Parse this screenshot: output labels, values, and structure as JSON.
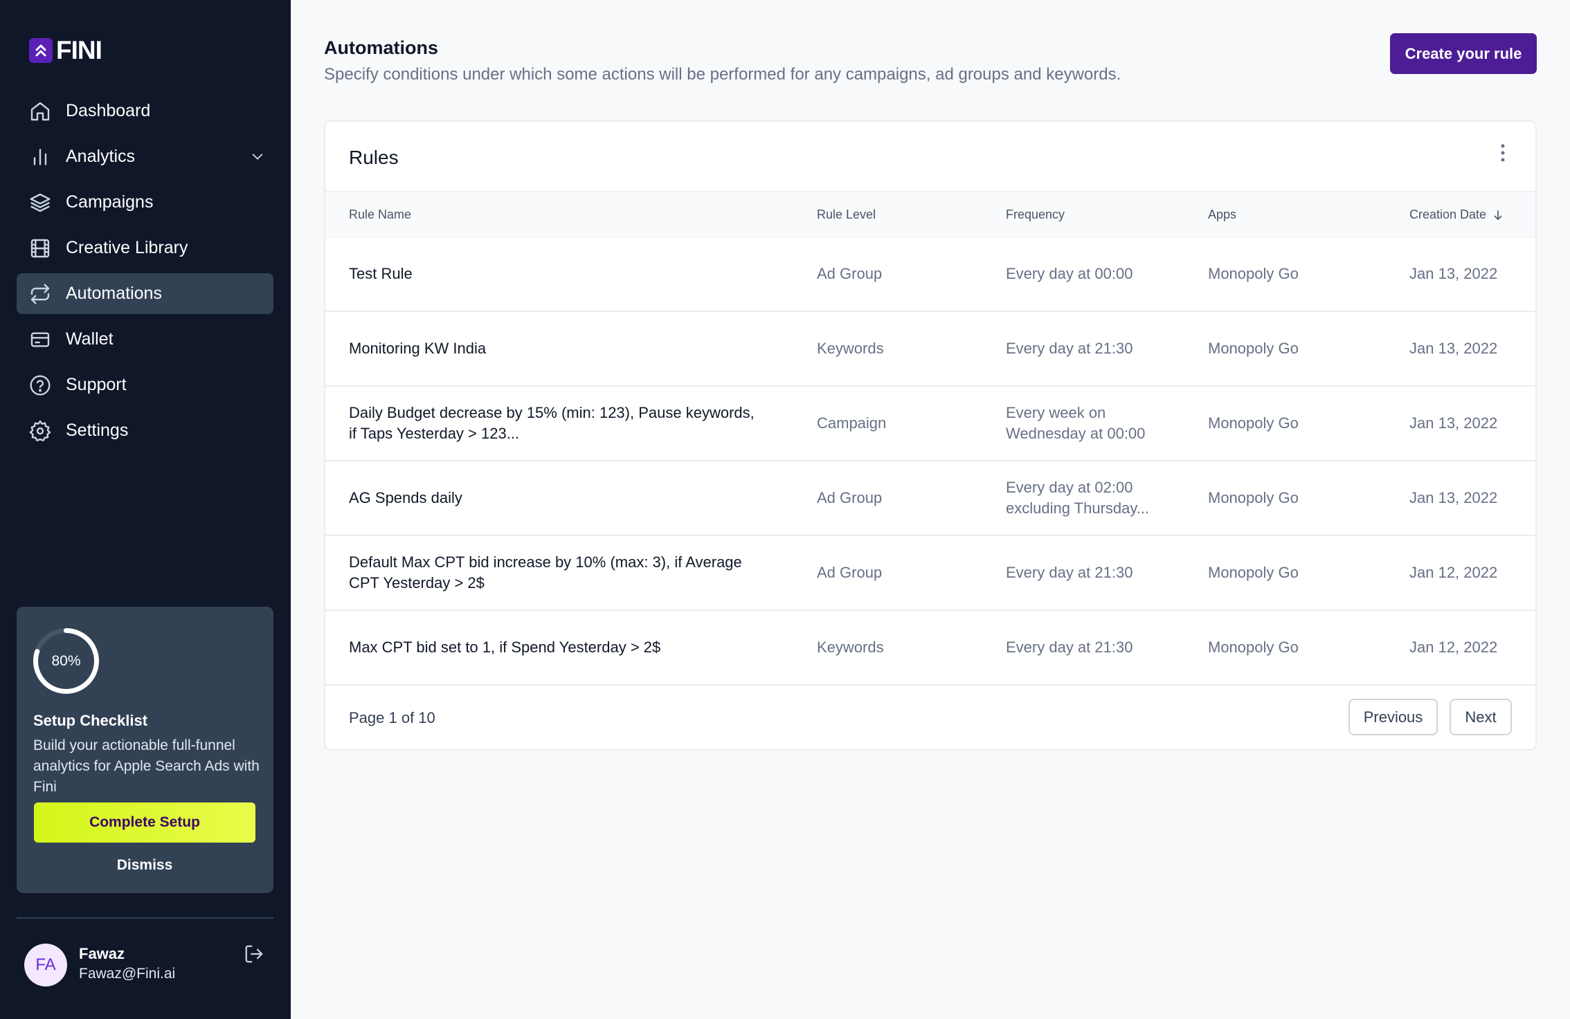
{
  "app": {
    "logo_text": "FINI"
  },
  "sidebar": {
    "items": [
      {
        "label": "Dashboard",
        "icon": "home-icon"
      },
      {
        "label": "Analytics",
        "icon": "bar-chart-icon"
      },
      {
        "label": "Campaigns",
        "icon": "layers-icon"
      },
      {
        "label": "Creative Library",
        "icon": "film-icon"
      },
      {
        "label": "Automations",
        "icon": "repeat-icon",
        "active": true
      },
      {
        "label": "Wallet",
        "icon": "wallet-icon"
      },
      {
        "label": "Support",
        "icon": "help-circle-icon"
      },
      {
        "label": "Settings",
        "icon": "gear-icon"
      }
    ],
    "setup": {
      "progress_label": "80%",
      "progress_value": 0.8,
      "title": "Setup Checklist",
      "description": "Build your actionable full-funnel analytics for Apple Search Ads with Fini",
      "complete_label": "Complete Setup",
      "dismiss_label": "Dismiss"
    },
    "user": {
      "initials": "FA",
      "name": "Fawaz",
      "email": "Fawaz@Fini.ai"
    }
  },
  "header": {
    "title": "Automations",
    "description": "Specify conditions under which some actions will be performed for any campaigns, ad groups and keywords.",
    "create_label": "Create your rule"
  },
  "rules": {
    "title": "Rules",
    "columns": [
      "Rule Name",
      "Rule Level",
      "Frequency",
      "Apps",
      "Creation Date"
    ],
    "rows": [
      {
        "name": "Test Rule",
        "level": "Ad Group",
        "frequency": "Every day at 00:00",
        "app": "Monopoly Go",
        "date": "Jan 13, 2022"
      },
      {
        "name": "Monitoring KW India",
        "level": "Keywords",
        "frequency": "Every day at 21:30",
        "app": "Monopoly Go",
        "date": "Jan 13, 2022"
      },
      {
        "name": "Daily Budget decrease by 15% (min: 123), Pause keywords, if Taps Yesterday > 123...",
        "level": "Campaign",
        "frequency": "Every week on Wednesday at 00:00",
        "app": "Monopoly Go",
        "date": "Jan 13, 2022"
      },
      {
        "name": "AG Spends daily",
        "level": "Ad Group",
        "frequency": "Every day at 02:00 excluding Thursday...",
        "app": "Monopoly Go",
        "date": "Jan 13, 2022"
      },
      {
        "name": "Default Max CPT bid increase by 10% (max: 3), if Average CPT Yesterday > 2$",
        "level": "Ad Group",
        "frequency": "Every day at 21:30",
        "app": "Monopoly Go",
        "date": "Jan 12, 2022"
      },
      {
        "name": "Max CPT bid set to 1, if Spend Yesterday > 2$",
        "level": "Keywords",
        "frequency": "Every day at 21:30",
        "app": "Monopoly Go",
        "date": "Jan 12, 2022"
      }
    ],
    "pagination": {
      "label": "Page 1 of 10",
      "previous": "Previous",
      "next": "Next"
    }
  },
  "colors": {
    "sidebar_bg": "#0f1729",
    "accent": "#4c1d95",
    "setup_button": "#d4f51a"
  }
}
